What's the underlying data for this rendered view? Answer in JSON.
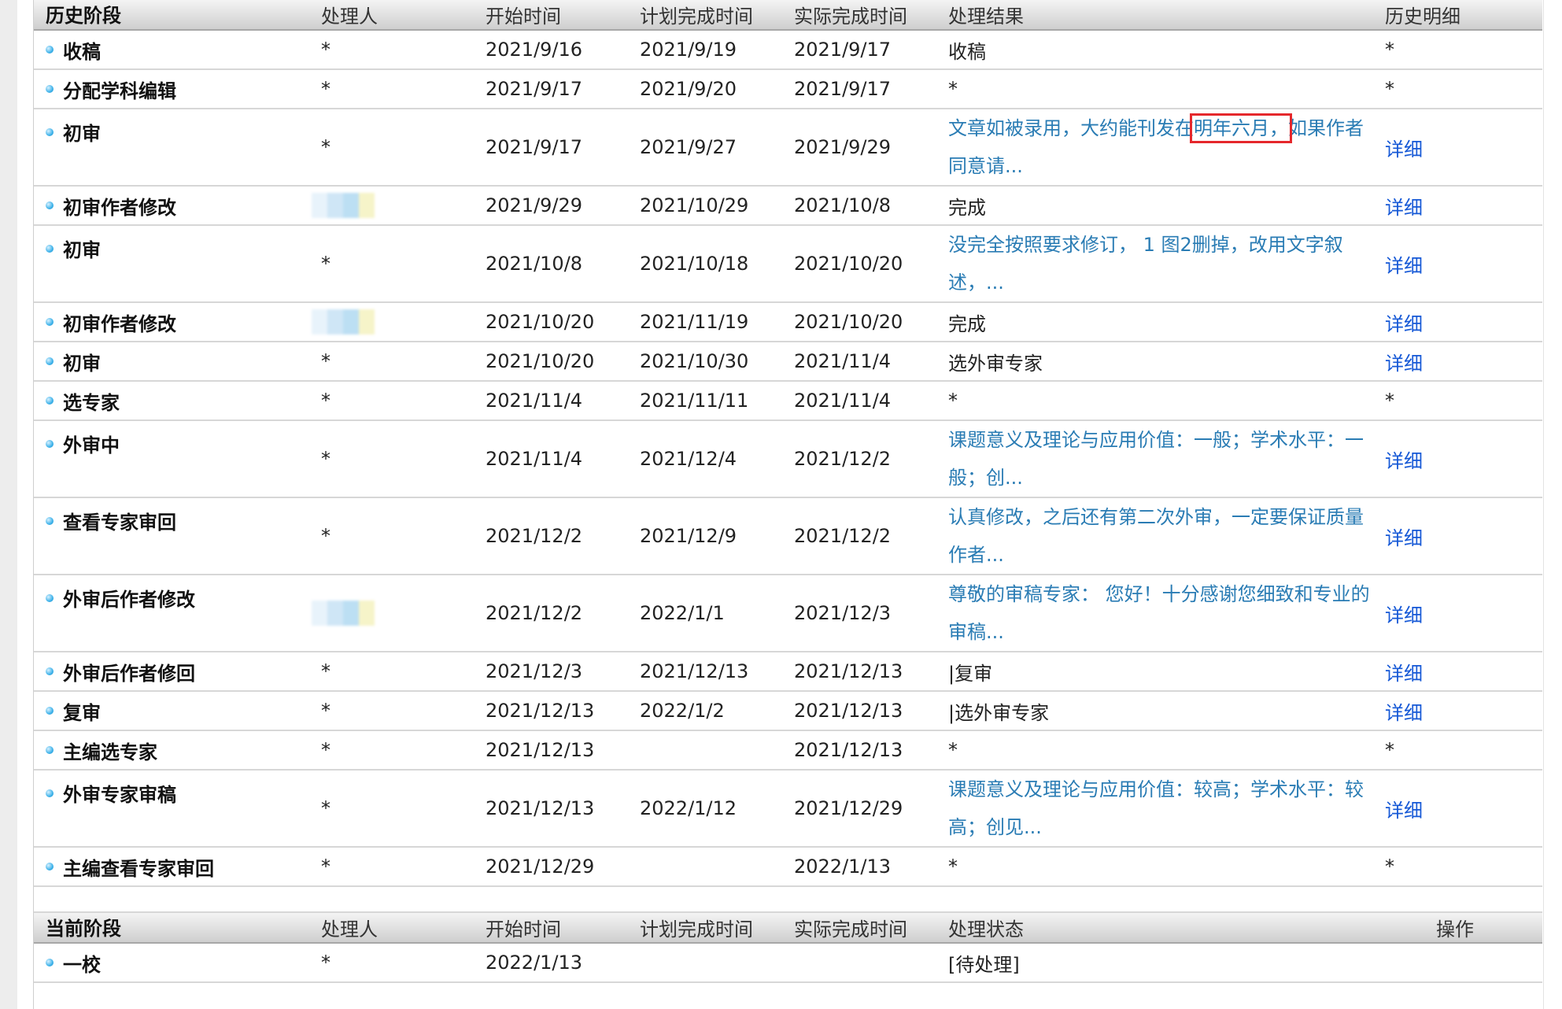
{
  "history": {
    "headers": {
      "stage": "历史阶段",
      "handler": "处理人",
      "start": "开始时间",
      "plan": "计划完成时间",
      "actual": "实际完成时间",
      "result": "处理结果",
      "detail": "历史明细"
    },
    "rows": [
      {
        "stage": "收稿",
        "handler": "*",
        "start": "2021/9/16",
        "plan": "2021/9/19",
        "actual": "2021/9/17",
        "result": "收稿",
        "detail": "*"
      },
      {
        "stage": "分配学科编辑",
        "handler": "*",
        "start": "2021/9/17",
        "plan": "2021/9/20",
        "actual": "2021/9/17",
        "result": "*",
        "detail": "*"
      },
      {
        "stage": "初审",
        "handler": "*",
        "start": "2021/9/17",
        "plan": "2021/9/27",
        "actual": "2021/9/29",
        "result_pre": "文章如被录用，大约能刊发在",
        "result_hl": "明年六月，",
        "result_post": "如果作者同意请...",
        "detail": "详细"
      },
      {
        "stage": "初审作者修改",
        "handler": "",
        "start": "2021/9/29",
        "plan": "2021/10/29",
        "actual": "2021/10/8",
        "result": "完成",
        "detail": "详细"
      },
      {
        "stage": "初审",
        "handler": "*",
        "start": "2021/10/8",
        "plan": "2021/10/18",
        "actual": "2021/10/20",
        "result": "没完全按照要求修订， 1 图2删掉，改用文字叙述，...",
        "detail": "详细"
      },
      {
        "stage": "初审作者修改",
        "handler": "",
        "start": "2021/10/20",
        "plan": "2021/11/19",
        "actual": "2021/10/20",
        "result": "完成",
        "detail": "详细"
      },
      {
        "stage": "初审",
        "handler": "*",
        "start": "2021/10/20",
        "plan": "2021/10/30",
        "actual": "2021/11/4",
        "result": "选外审专家",
        "detail": "详细"
      },
      {
        "stage": "选专家",
        "handler": "*",
        "start": "2021/11/4",
        "plan": "2021/11/11",
        "actual": "2021/11/4",
        "result": "*",
        "detail": "*"
      },
      {
        "stage": "外审中",
        "handler": "*",
        "start": "2021/11/4",
        "plan": "2021/12/4",
        "actual": "2021/12/2",
        "result": "课题意义及理论与应用价值：一般；学术水平：一般；创...",
        "detail": "详细"
      },
      {
        "stage": "查看专家审回",
        "handler": "*",
        "start": "2021/12/2",
        "plan": "2021/12/9",
        "actual": "2021/12/2",
        "result": "认真修改，之后还有第二次外审，一定要保证质量作者...",
        "detail": "详细"
      },
      {
        "stage": "外审后作者修改",
        "handler": "",
        "start": "2021/12/2",
        "plan": "2022/1/1",
        "actual": "2021/12/3",
        "result": "尊敬的审稿专家： 您好！十分感谢您细致和专业的审稿...",
        "detail": "详细"
      },
      {
        "stage": "外审后作者修回",
        "handler": "*",
        "start": "2021/12/3",
        "plan": "2021/12/13",
        "actual": "2021/12/13",
        "result": "|复审",
        "detail": "详细"
      },
      {
        "stage": "复审",
        "handler": "*",
        "start": "2021/12/13",
        "plan": "2022/1/2",
        "actual": "2021/12/13",
        "result": "|选外审专家",
        "detail": "详细"
      },
      {
        "stage": "主编选专家",
        "handler": "*",
        "start": "2021/12/13",
        "plan": "",
        "actual": "2021/12/13",
        "result": "*",
        "detail": "*"
      },
      {
        "stage": "外审专家审稿",
        "handler": "*",
        "start": "2021/12/13",
        "plan": "2022/1/12",
        "actual": "2021/12/29",
        "result": "课题意义及理论与应用价值：较高；学术水平：较高；创见...",
        "detail": "详细"
      },
      {
        "stage": "主编查看专家审回",
        "handler": "*",
        "start": "2021/12/29",
        "plan": "",
        "actual": "2022/1/13",
        "result": "*",
        "detail": "*"
      }
    ]
  },
  "current": {
    "headers": {
      "stage": "当前阶段",
      "handler": "处理人",
      "start": "开始时间",
      "plan": "计划完成时间",
      "actual": "实际完成时间",
      "status": "处理状态",
      "action": "操作"
    },
    "rows": [
      {
        "stage": "一校",
        "handler": "*",
        "start": "2022/1/13",
        "plan": "",
        "actual": "",
        "status": "[待处理]",
        "action": ""
      }
    ]
  },
  "colors": {
    "link": "#1558d6",
    "result_link": "#2a7cb4",
    "highlight": "#e5282c",
    "status_dot": "#3fb3ea"
  },
  "icons": {
    "row_bullet": "blue-dot-icon"
  }
}
